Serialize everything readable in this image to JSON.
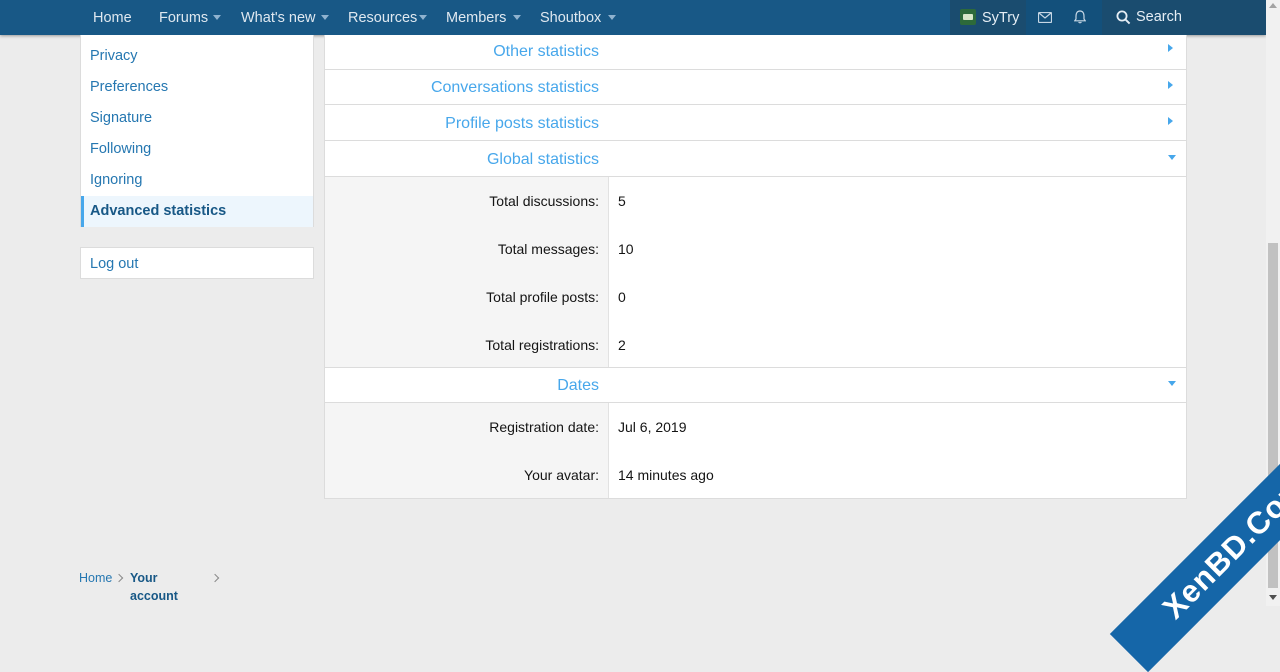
{
  "nav": {
    "items": [
      {
        "label": "Home"
      },
      {
        "label": "Forums"
      },
      {
        "label": "What's new"
      },
      {
        "label": "Resources"
      },
      {
        "label": "Members"
      },
      {
        "label": "Shoutbox"
      }
    ],
    "user_name": "SyTry",
    "search_label": "Search",
    "icons": [
      "envelope-icon",
      "bell-icon",
      "search-icon"
    ]
  },
  "sidebar": {
    "items": [
      {
        "label": "Privacy"
      },
      {
        "label": "Preferences"
      },
      {
        "label": "Signature"
      },
      {
        "label": "Following"
      },
      {
        "label": "Ignoring"
      },
      {
        "label": "Advanced statistics",
        "active": true
      }
    ],
    "logout_label": "Log out"
  },
  "main": {
    "sections": [
      {
        "title": "Other statistics",
        "expanded": false
      },
      {
        "title": "Conversations statistics",
        "expanded": false
      },
      {
        "title": "Profile posts statistics",
        "expanded": false
      },
      {
        "title": "Global statistics",
        "expanded": true
      },
      {
        "title": "Dates",
        "expanded": true
      }
    ],
    "global_rows": [
      {
        "label": "Total discussions:",
        "value": "5"
      },
      {
        "label": "Total messages:",
        "value": "10"
      },
      {
        "label": "Total profile posts:",
        "value": "0"
      },
      {
        "label": "Total registrations:",
        "value": "2"
      }
    ],
    "date_rows": [
      {
        "label": "Registration date:",
        "value": "Jul 6, 2019"
      },
      {
        "label": "Your avatar:",
        "value": "14 minutes ago"
      }
    ]
  },
  "breadcrumb": {
    "items": [
      {
        "label": "Home"
      },
      {
        "label": "Your account"
      }
    ]
  },
  "watermark": "XenBD.Com",
  "colors": {
    "nav_bg": "#185886",
    "accent": "#47a7eb",
    "link": "#2577b1",
    "page_bg": "#ececec"
  }
}
